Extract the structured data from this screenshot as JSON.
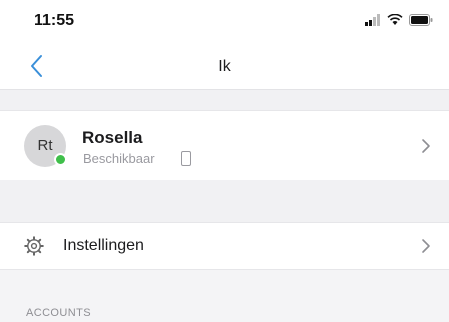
{
  "status_bar": {
    "time": "11:55",
    "icons": [
      "signal-icon",
      "wifi-icon",
      "battery-icon"
    ]
  },
  "nav": {
    "back_icon": "chevron-left-icon",
    "title": "Ik"
  },
  "profile": {
    "avatar_initials": "Rt",
    "name": "Rosella",
    "status": "Beschikbaar",
    "presence_color": "#3fbf4a",
    "device_icon": "phone-icon",
    "chevron_icon": "chevron-right-icon"
  },
  "settings": {
    "icon": "gear-icon",
    "label": "Instellingen",
    "chevron_icon": "chevron-right-icon"
  },
  "accounts": {
    "header": "ACCOUNTS"
  },
  "colors": {
    "accent": "#3a8fd9",
    "background": "#f4f4f6"
  }
}
